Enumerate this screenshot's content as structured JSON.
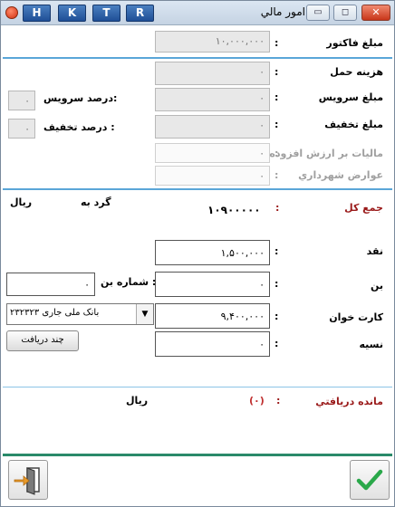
{
  "title": "امور مالي",
  "hotkeys": [
    "H",
    "K",
    "T",
    "R"
  ],
  "fields": {
    "invoice_amount": {
      "label": "مبلغ فاکتور",
      "value": "۱۰,۰۰۰,۰۰۰"
    },
    "shipping_cost": {
      "label": "هزينه حمل",
      "value": "۰"
    },
    "service_amount": {
      "label": "مبلغ سرويس",
      "value": "۰"
    },
    "discount_amount": {
      "label": "مبلغ تخفيف",
      "value": "۰"
    },
    "vat": {
      "label": "ماليات بر ارزش افزوده",
      "value": "۰"
    },
    "municipal_fee": {
      "label": "عوارض شهرداري",
      "value": "۰"
    },
    "service_percent": {
      "label": "درصد سرويس:",
      "value": "۰"
    },
    "discount_percent": {
      "label": "درصد تخفيف :",
      "value": "۰"
    }
  },
  "total": {
    "label": "جمع کل",
    "value": "۱۰۹۰۰۰۰۰",
    "round_label": "گرد به",
    "currency": "ريال"
  },
  "payments": {
    "cash": {
      "label": "نقد",
      "value": "۱,۵۰۰,۰۰۰"
    },
    "voucher": {
      "label": "بن",
      "value": "۰"
    },
    "voucher_no_label": "شماره بن :",
    "voucher_no_value": "۰",
    "card_reader": {
      "label": "کارت خوان",
      "value": "۹,۴۰۰,۰۰۰"
    },
    "bank_account": "بانک ملی جاری ۲۳۲۳۲۳",
    "multi_receive_label": "چند دريافت",
    "credit": {
      "label": "نسيه",
      "value": "۰"
    }
  },
  "remaining": {
    "label": "مانده دريافتي",
    "value": "(۰)",
    "currency": "ريال"
  },
  "colon": ":",
  "colors": {
    "accent": "#5aa6d8",
    "red_label": "#9a1a1a",
    "ok_check": "#2aa84a",
    "exit_orange": "#e89a2a"
  }
}
